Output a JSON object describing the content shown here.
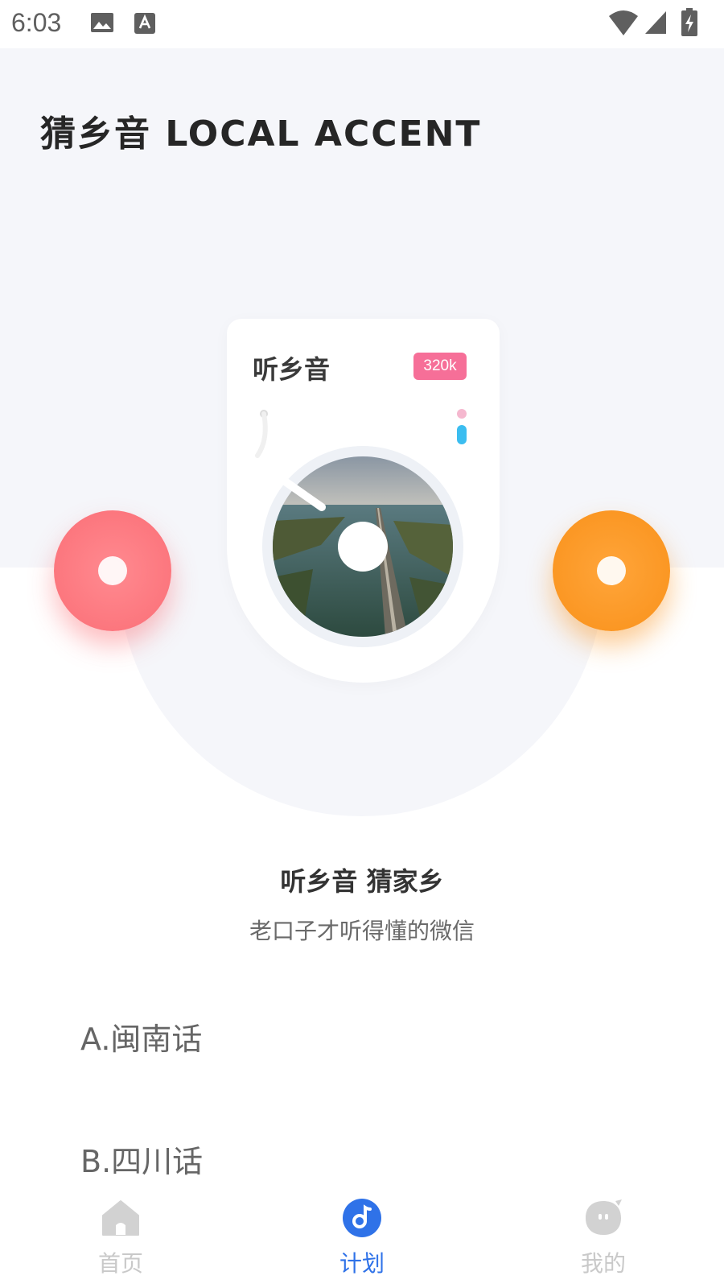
{
  "status_bar": {
    "time": "6:03",
    "icons": [
      "image-icon",
      "a-badge-icon",
      "wifi-icon",
      "cellular-signal-icon",
      "battery-charging-icon"
    ]
  },
  "header": {
    "title": "猜乡音  LOCAL ACCENT"
  },
  "player_card": {
    "title": "听乡音",
    "quality_badge": "320k",
    "badge_color": "#f66f98"
  },
  "discs": {
    "left_color": "#fb6e76",
    "right_color": "#f9911a"
  },
  "intro": {
    "headline": "听乡音 猜家乡",
    "subline": "老口子才听得懂的微信"
  },
  "options": [
    {
      "label": "A.闽南话"
    },
    {
      "label": "B.四川话"
    }
  ],
  "bottom_nav": {
    "items": [
      {
        "label": "首页",
        "icon": "home-icon",
        "active": false
      },
      {
        "label": "计划",
        "icon": "music-note-icon",
        "active": true
      },
      {
        "label": "我的",
        "icon": "chat-face-icon",
        "active": false
      }
    ],
    "active_color": "#2f72e8",
    "inactive_color": "#c9c9c9"
  }
}
